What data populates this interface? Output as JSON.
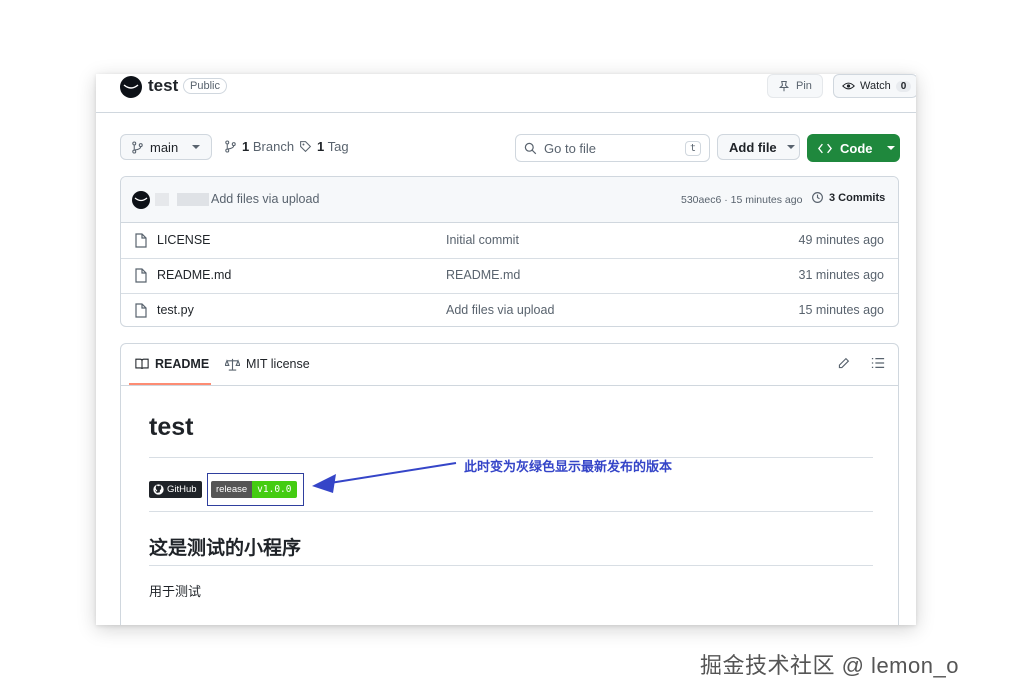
{
  "repo": {
    "name": "test",
    "visibility": "Public"
  },
  "header_actions": {
    "pin_label": "Pin",
    "watch_label": "Watch",
    "watch_count": "0"
  },
  "toolbar": {
    "branch": "main",
    "branch_count": "1",
    "branch_label": "Branch",
    "tag_count": "1",
    "tag_label": "Tag",
    "goto_placeholder": "Go to file",
    "goto_shortcut": "t",
    "add_file_label": "Add file",
    "code_label": "Code"
  },
  "latest_commit": {
    "message": "Add files via upload",
    "meta": "530aec6 · 15 minutes ago",
    "commits_label": "3 Commits"
  },
  "files": [
    {
      "name": "LICENSE",
      "message": "Initial commit",
      "time": "49 minutes ago"
    },
    {
      "name": "README.md",
      "message": "README.md",
      "time": "31 minutes ago"
    },
    {
      "name": "test.py",
      "message": "Add files via upload",
      "time": "15 minutes ago"
    }
  ],
  "readme": {
    "tab_readme": "README",
    "tab_license": "MIT license",
    "title": "test",
    "badge_github": "GitHub",
    "badge_release_label": "release",
    "badge_release_value": "v1.0.0",
    "heading2": "这是测试的小程序",
    "paragraph": "用于测试"
  },
  "annotation": {
    "text": "此时变为灰绿色显示最新发布的版本",
    "color": "#3545c8"
  },
  "watermark": "掘金技术社区 @ lemon_o",
  "colors": {
    "code_button": "#1f883d",
    "release_value": "#44cc11",
    "tab_underline": "#fd8c73"
  }
}
